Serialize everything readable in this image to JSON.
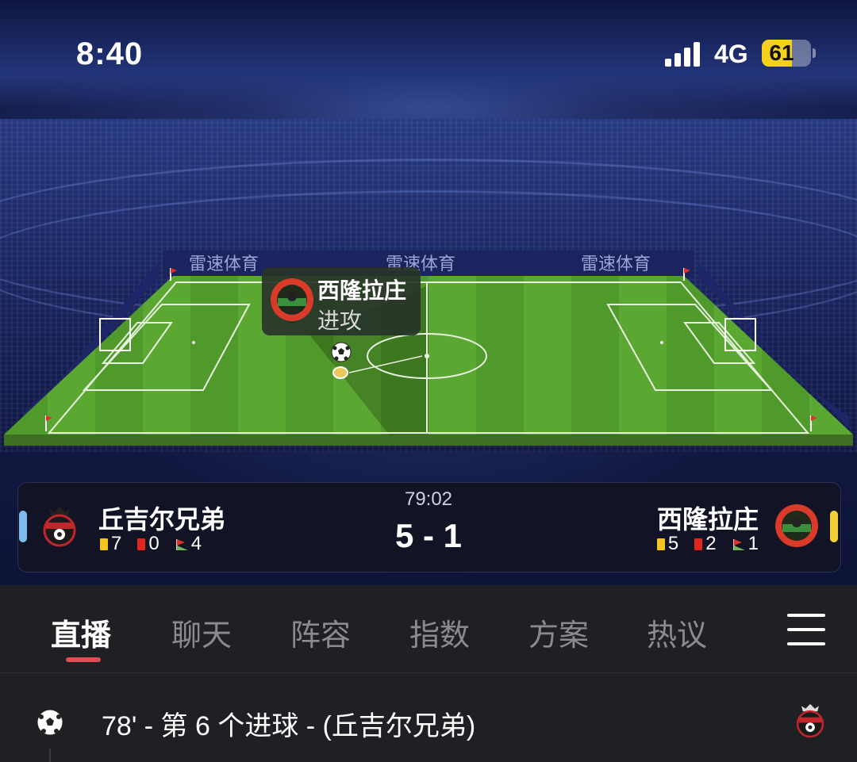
{
  "status_bar": {
    "time": "8:40",
    "network": "4G",
    "battery": "61",
    "battery_level": 0.61
  },
  "pitch": {
    "ad_text": "雷速体育",
    "tooltip": {
      "team": "西隆拉庄",
      "action": "进攻"
    }
  },
  "match": {
    "clock": "79:02",
    "score": "5 - 1",
    "home": {
      "name": "丘吉尔兄弟",
      "yellow": "7",
      "red": "0",
      "corners": "4",
      "color": "#7dbaf0"
    },
    "away": {
      "name": "西隆拉庄",
      "yellow": "5",
      "red": "2",
      "corners": "1",
      "color": "#f2cf3b"
    }
  },
  "tabs": [
    "直播",
    "聊天",
    "阵容",
    "指数",
    "方案",
    "热议"
  ],
  "active_tab": "直播",
  "events": [
    {
      "text": "78' - 第 6 个进球 - (丘吉尔兄弟)"
    }
  ],
  "icons": [
    "cellular-signal-icon",
    "battery-icon",
    "soccer-ball-icon",
    "yellow-card-icon",
    "red-card-icon",
    "corner-flag-icon",
    "menu-icon"
  ]
}
